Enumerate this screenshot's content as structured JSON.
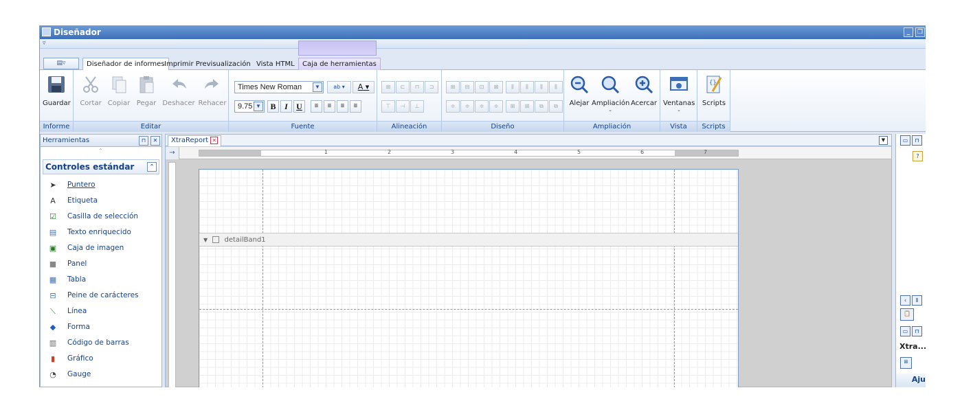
{
  "window": {
    "title": "Diseñador",
    "controls": [
      "_",
      "❐"
    ]
  },
  "qat": {
    "menu_glyph": "▿"
  },
  "appmenu": {
    "glyph": "▤▿"
  },
  "tabs": [
    {
      "label": "Diseñador de informes"
    },
    {
      "label": "Imprimir Previsualización"
    },
    {
      "label": "Vista HTML"
    },
    {
      "label": "Caja de herramientas"
    }
  ],
  "ribbon": {
    "groups": [
      {
        "label": "Informe"
      },
      {
        "label": "Editar"
      },
      {
        "label": "Fuente"
      },
      {
        "label": "Alineación"
      },
      {
        "label": "Diseño"
      },
      {
        "label": "Ampliación"
      },
      {
        "label": "Vista"
      },
      {
        "label": "Scripts"
      }
    ],
    "buttons": {
      "guardar": "Guardar",
      "cortar": "Cortar",
      "copiar": "Copiar",
      "pegar": "Pegar",
      "deshacer": "Deshacer",
      "rehacer": "Rehacer",
      "alejar": "Alejar",
      "ampliacion": "Ampliación",
      "acercar": "Acercar",
      "ventanas": "Ventanas",
      "scripts": "Scripts"
    },
    "font": {
      "name": "Times New Roman",
      "size": "9.75",
      "bold": "B",
      "italic": "I",
      "underline": "U",
      "fontcolor": "A",
      "backcolor": "ab"
    }
  },
  "toolbox": {
    "header": "Herramientas",
    "section": "Controles estándar",
    "items": [
      {
        "label": "Puntero",
        "icon": "pointer-icon",
        "glyph": "➤"
      },
      {
        "label": "Etiqueta",
        "icon": "label-icon",
        "glyph": "A"
      },
      {
        "label": "Casilla de selección",
        "icon": "checkbox-icon",
        "glyph": "☑"
      },
      {
        "label": "Texto enriquecido",
        "icon": "richtext-icon",
        "glyph": "▤"
      },
      {
        "label": "Caja de imagen",
        "icon": "picture-icon",
        "glyph": "▣"
      },
      {
        "label": "Panel",
        "icon": "panel-icon",
        "glyph": "■"
      },
      {
        "label": "Tabla",
        "icon": "table-icon",
        "glyph": "▦"
      },
      {
        "label": "Peine de carácteres",
        "icon": "charcomb-icon",
        "glyph": "⊟"
      },
      {
        "label": "Línea",
        "icon": "line-icon",
        "glyph": "⟍"
      },
      {
        "label": "Forma",
        "icon": "shape-icon",
        "glyph": "◆"
      },
      {
        "label": "Código de barras",
        "icon": "barcode-icon",
        "glyph": "▥"
      },
      {
        "label": "Gráfico",
        "icon": "chart-icon",
        "glyph": "▮"
      },
      {
        "label": "Gauge",
        "icon": "gauge-icon",
        "glyph": "◔"
      }
    ]
  },
  "document": {
    "tab": "XtraReport",
    "band": "detailBand1",
    "ruler_numbers": [
      "1",
      "2",
      "3",
      "4",
      "5",
      "6",
      "7"
    ],
    "corner_glyph": "→"
  },
  "rightpanel": {
    "title": "Xtra...",
    "ajustes": "Aju"
  },
  "colors": {
    "title_bar": "#3d6fb8",
    "context_tab": "#d7d2f7",
    "group_label": "#15428b"
  }
}
